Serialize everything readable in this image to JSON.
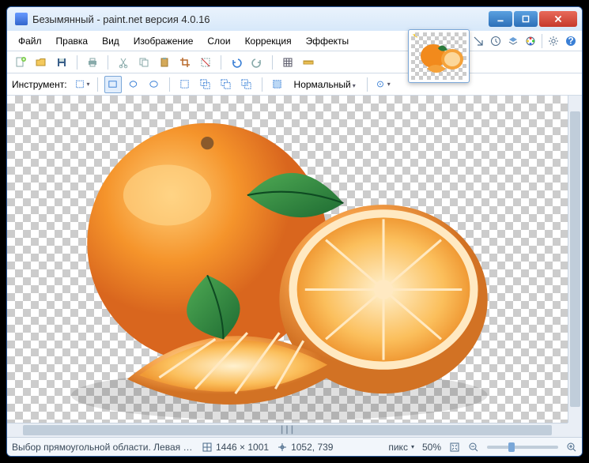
{
  "app": {
    "title": "Безымянный - paint.net версия 4.0.16"
  },
  "menus": {
    "file": "Файл",
    "edit": "Правка",
    "view": "Вид",
    "image": "Изображение",
    "layers": "Слои",
    "adjustments": "Коррекция",
    "effects": "Эффекты"
  },
  "options": {
    "tool_label": "Инструмент:",
    "blend_mode": "Нормальный"
  },
  "status": {
    "text": "Выбор прямоугольной области. Левая кнопка - выделе…",
    "image_size": "1446 × 1001",
    "cursor_pos": "1052, 739",
    "units": "пикс",
    "zoom": "50%"
  },
  "icons": {
    "search": "search-icon",
    "history": "history-icon",
    "layers": "layers-icon",
    "colors": "colors-icon",
    "settings": "gear-icon",
    "help": "help-icon"
  }
}
